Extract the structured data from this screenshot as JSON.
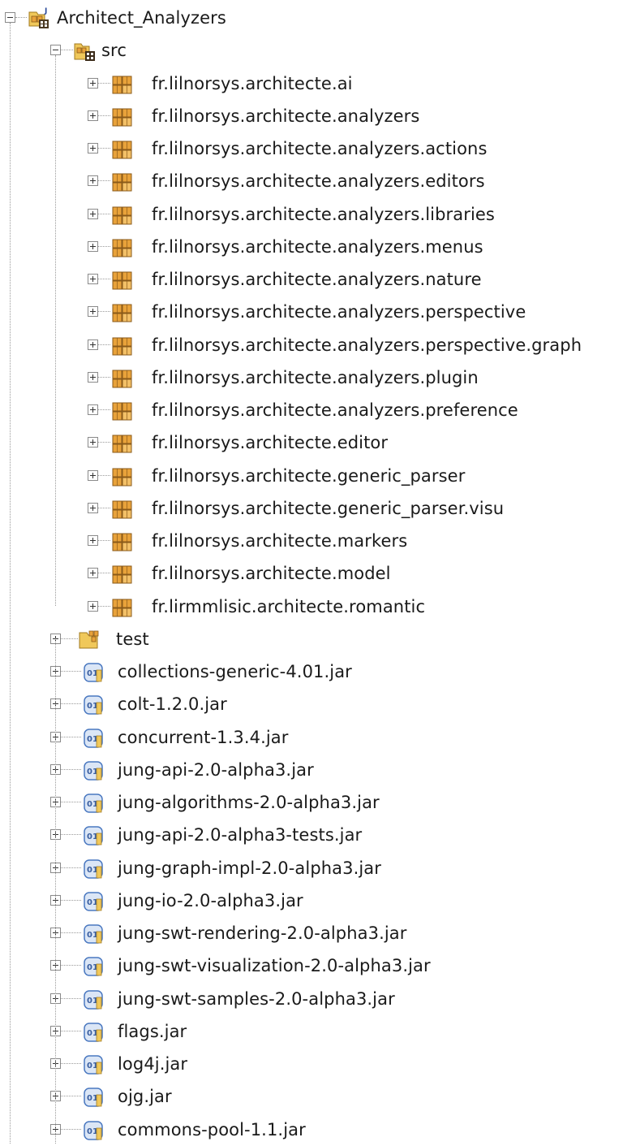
{
  "project": {
    "label": "Architect_Analyzers",
    "icon": "java-project-icon",
    "expanded": true
  },
  "src_folder": {
    "label": "src",
    "icon": "source-folder-icon",
    "expanded": true
  },
  "packages": [
    {
      "label": "fr.lilnorsys.architecte.ai",
      "icon": "package-icon"
    },
    {
      "label": "fr.lilnorsys.architecte.analyzers",
      "icon": "package-icon"
    },
    {
      "label": "fr.lilnorsys.architecte.analyzers.actions",
      "icon": "package-icon"
    },
    {
      "label": "fr.lilnorsys.architecte.analyzers.editors",
      "icon": "package-icon"
    },
    {
      "label": "fr.lilnorsys.architecte.analyzers.libraries",
      "icon": "package-icon"
    },
    {
      "label": "fr.lilnorsys.architecte.analyzers.menus",
      "icon": "package-icon"
    },
    {
      "label": "fr.lilnorsys.architecte.analyzers.nature",
      "icon": "package-icon"
    },
    {
      "label": "fr.lilnorsys.architecte.analyzers.perspective",
      "icon": "package-icon"
    },
    {
      "label": "fr.lilnorsys.architecte.analyzers.perspective.graph",
      "icon": "package-icon"
    },
    {
      "label": "fr.lilnorsys.architecte.analyzers.plugin",
      "icon": "package-icon"
    },
    {
      "label": "fr.lilnorsys.architecte.analyzers.preference",
      "icon": "package-icon"
    },
    {
      "label": "fr.lilnorsys.architecte.editor",
      "icon": "package-icon"
    },
    {
      "label": "fr.lilnorsys.architecte.generic_parser",
      "icon": "package-icon"
    },
    {
      "label": "fr.lilnorsys.architecte.generic_parser.visu",
      "icon": "package-icon"
    },
    {
      "label": "fr.lilnorsys.architecte.markers",
      "icon": "package-icon"
    },
    {
      "label": "fr.lilnorsys.architecte.model",
      "icon": "package-icon"
    },
    {
      "label": "fr.lirmmlisic.architecte.romantic",
      "icon": "package-icon"
    }
  ],
  "test_folder": {
    "label": "test",
    "icon": "folder-icon"
  },
  "jars": [
    {
      "label": "collections-generic-4.01.jar",
      "icon": "jar-icon"
    },
    {
      "label": "colt-1.2.0.jar",
      "icon": "jar-icon"
    },
    {
      "label": "concurrent-1.3.4.jar",
      "icon": "jar-icon"
    },
    {
      "label": "jung-api-2.0-alpha3.jar",
      "icon": "jar-icon"
    },
    {
      "label": "jung-algorithms-2.0-alpha3.jar",
      "icon": "jar-icon"
    },
    {
      "label": "jung-api-2.0-alpha3-tests.jar",
      "icon": "jar-icon"
    },
    {
      "label": "jung-graph-impl-2.0-alpha3.jar",
      "icon": "jar-icon"
    },
    {
      "label": "jung-io-2.0-alpha3.jar",
      "icon": "jar-icon"
    },
    {
      "label": "jung-swt-rendering-2.0-alpha3.jar",
      "icon": "jar-icon"
    },
    {
      "label": "jung-swt-visualization-2.0-alpha3.jar",
      "icon": "jar-icon"
    },
    {
      "label": "jung-swt-samples-2.0-alpha3.jar",
      "icon": "jar-icon"
    },
    {
      "label": "flags.jar",
      "icon": "jar-icon"
    },
    {
      "label": "log4j.jar",
      "icon": "jar-icon"
    },
    {
      "label": "ojg.jar",
      "icon": "jar-icon"
    },
    {
      "label": "commons-pool-1.1.jar",
      "icon": "jar-icon"
    }
  ],
  "colors": {
    "package_orange": "#e8a23a",
    "package_brown": "#8a5a1a",
    "jar_blue": "#4a78c0",
    "folder_yellow": "#f0c85a"
  }
}
